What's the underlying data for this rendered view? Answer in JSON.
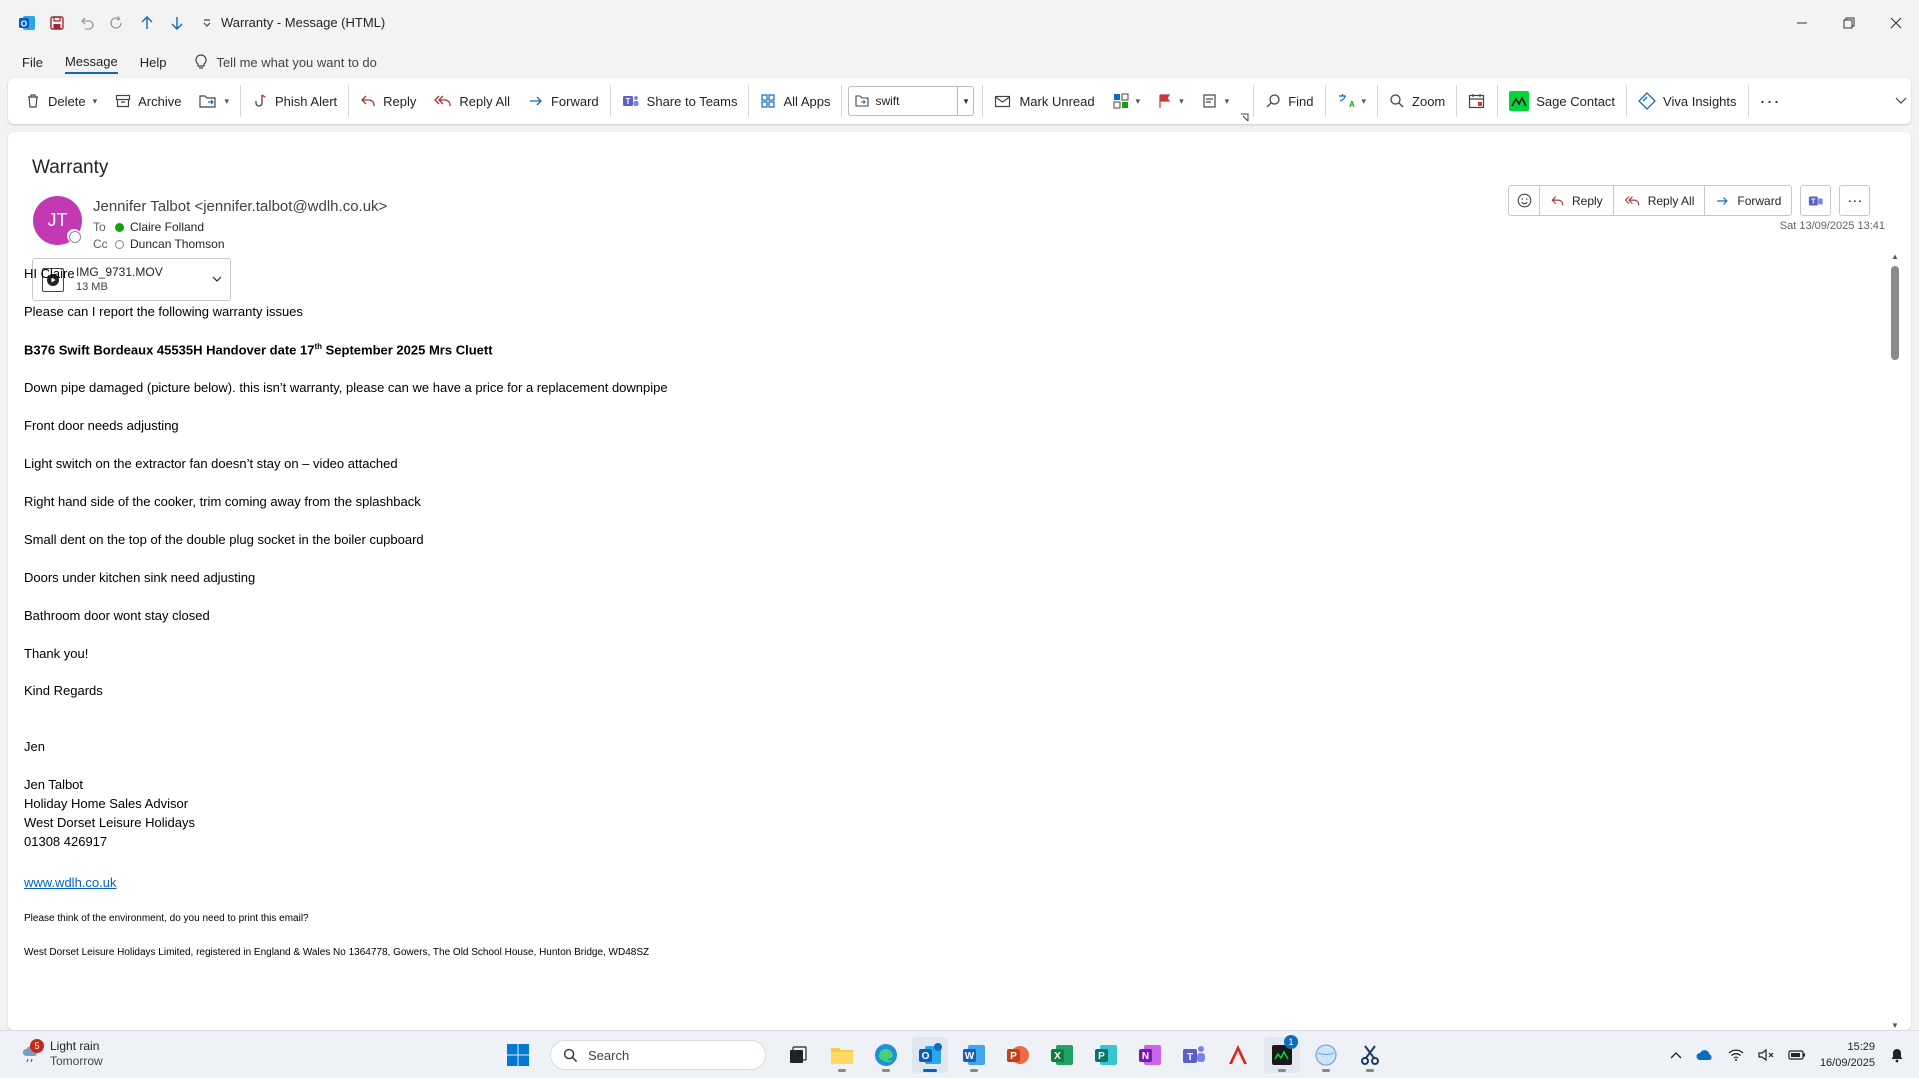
{
  "window": {
    "title": "Warranty  -  Message (HTML)",
    "controls": [
      "minimize-icon",
      "restore-icon",
      "close-icon"
    ]
  },
  "menu": {
    "items": [
      "File",
      "Message",
      "Help"
    ],
    "active": "Message",
    "tell_me": "Tell me what you want to do"
  },
  "ribbon": {
    "delete": "Delete",
    "archive": "Archive",
    "phish_alert": "Phish Alert",
    "reply": "Reply",
    "reply_all": "Reply All",
    "forward": "Forward",
    "share_to_teams": "Share to Teams",
    "all_apps": "All Apps",
    "quick_step_value": "swift",
    "mark_unread": "Mark Unread",
    "find": "Find",
    "zoom": "Zoom",
    "sage_contact": "Sage Contact",
    "viva_insights": "Viva Insights"
  },
  "message": {
    "subject": "Warranty",
    "avatar_initials": "JT",
    "sender": "Jennifer Talbot <jennifer.talbot@wdlh.co.uk>",
    "to_label": "To",
    "to": "Claire Folland",
    "cc_label": "Cc",
    "cc": "Duncan Thomson",
    "sent": "Sat 13/09/2025 13:41",
    "attachment": {
      "name": "IMG_9731.MOV",
      "size": "13 MB"
    },
    "actions": {
      "reply": "Reply",
      "reply_all": "Reply All",
      "forward": "Forward"
    }
  },
  "body": {
    "greeting": "HI Claire",
    "intro": "Please can I report the following warranty issues",
    "heading_a": "B376 Swift Bordeaux 45535H Handover date 17",
    "heading_sup": "th",
    "heading_b": " September 2025 Mrs Cluett",
    "items": [
      "Down pipe damaged (picture below). this isn’t warranty, please can we have a price for a replacement downpipe",
      "Front door needs adjusting",
      "Light switch on the extractor fan doesn’t stay on – video attached",
      "Right hand side of the cooker, trim coming away from the splashback",
      "Small dent on the top of the double plug socket in the boiler cupboard",
      "Doors under kitchen sink need adjusting",
      "Bathroom door wont stay closed"
    ],
    "thanks": "Thank you!",
    "regards": "Kind Regards",
    "signoff": "Jen",
    "sig_name": "Jen Talbot",
    "sig_title": "Holiday Home Sales Advisor",
    "sig_company": "West Dorset Leisure Holidays",
    "sig_phone": "01308 426917",
    "sig_web": "www.wdlh.co.uk",
    "env_note": "Please think of the environment, do you need to print this email?",
    "legal": "West Dorset Leisure Holidays Limited, registered in England & Wales No 1364778, Gowers, The Old School House, Hunton Bridge, WD48SZ"
  },
  "taskbar": {
    "weather_badge": "5",
    "weather_line1": "Light rain",
    "weather_line2": "Tomorrow",
    "search": "Search",
    "teams_badge": "1",
    "time": "15:29",
    "date": "16/09/2025"
  },
  "colors": {
    "accent": "#0f6cbd",
    "avatar": "#c239b3",
    "link": "#0563c1"
  }
}
